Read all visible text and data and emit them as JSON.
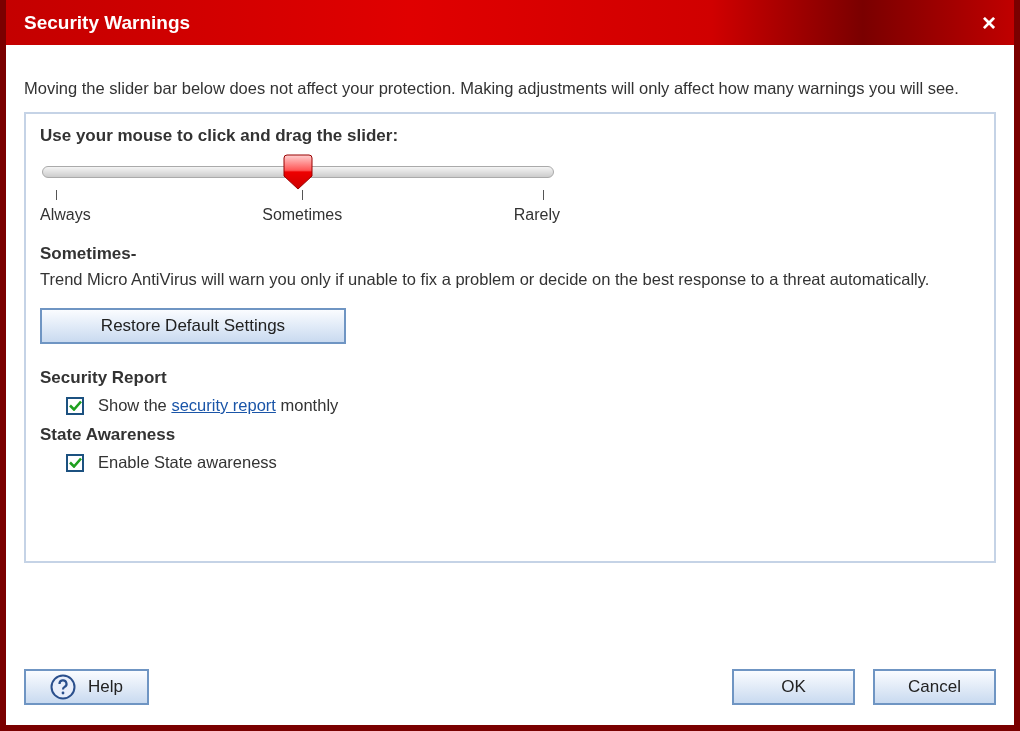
{
  "window": {
    "title": "Security Warnings",
    "close": "×"
  },
  "intro": "Moving the slider bar below does not affect your protection. Making adjustments will only affect how many warnings you will see.",
  "slider": {
    "prompt": "Use your mouse to click and drag the slider:",
    "level": 0.5,
    "ticks": [
      "Always",
      "Sometimes",
      "Rarely"
    ]
  },
  "description": {
    "heading": "Sometimes-",
    "text": "Trend Micro AntiVirus will warn you only if unable to fix a problem or decide on the best response to a threat automatically."
  },
  "restore_button": {
    "label": "Restore Default Settings"
  },
  "sections": [
    {
      "heading": "Security Report",
      "checkbox": {
        "checked": true,
        "before": "Show the ",
        "link": "security report",
        "after": " monthly"
      }
    },
    {
      "heading": "State Awareness",
      "checkbox": {
        "checked": true,
        "before": "Enable State awareness"
      }
    }
  ],
  "buttons": [
    {
      "kind": "help",
      "label": "Help"
    },
    {
      "kind": "plain",
      "label": "OK"
    },
    {
      "kind": "plain",
      "label": "Cancel"
    }
  ]
}
